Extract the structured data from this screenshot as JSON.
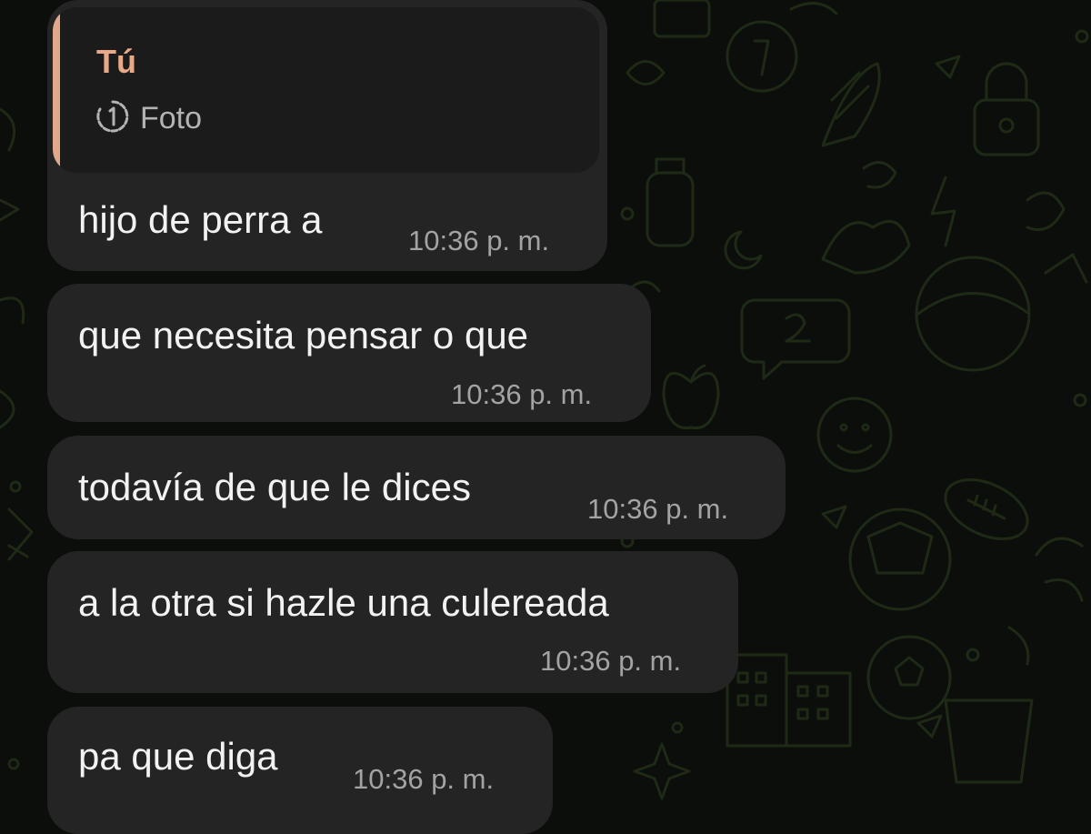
{
  "theme": {
    "background": "#0b0e0a",
    "doodle_color": "#1f2a16",
    "bubble_color": "#242424",
    "quote_bg": "#1b1b1b",
    "quote_accent": "#e1a88c",
    "text_color": "#f2f2f2",
    "time_color": "#a3a3a3"
  },
  "quoted": {
    "author": "Tú",
    "icon": "view-once-icon",
    "label": "Foto"
  },
  "messages": [
    {
      "text": "hijo de perra a",
      "time": "10:36 p. m."
    },
    {
      "text": "que necesita pensar o que",
      "time": "10:36 p. m."
    },
    {
      "text": "todavía de que le dices",
      "time": "10:36 p. m."
    },
    {
      "text": "a la otra si hazle una culereada",
      "time": "10:36 p. m."
    },
    {
      "text": "pa que diga",
      "time": "10:36 p. m."
    }
  ]
}
